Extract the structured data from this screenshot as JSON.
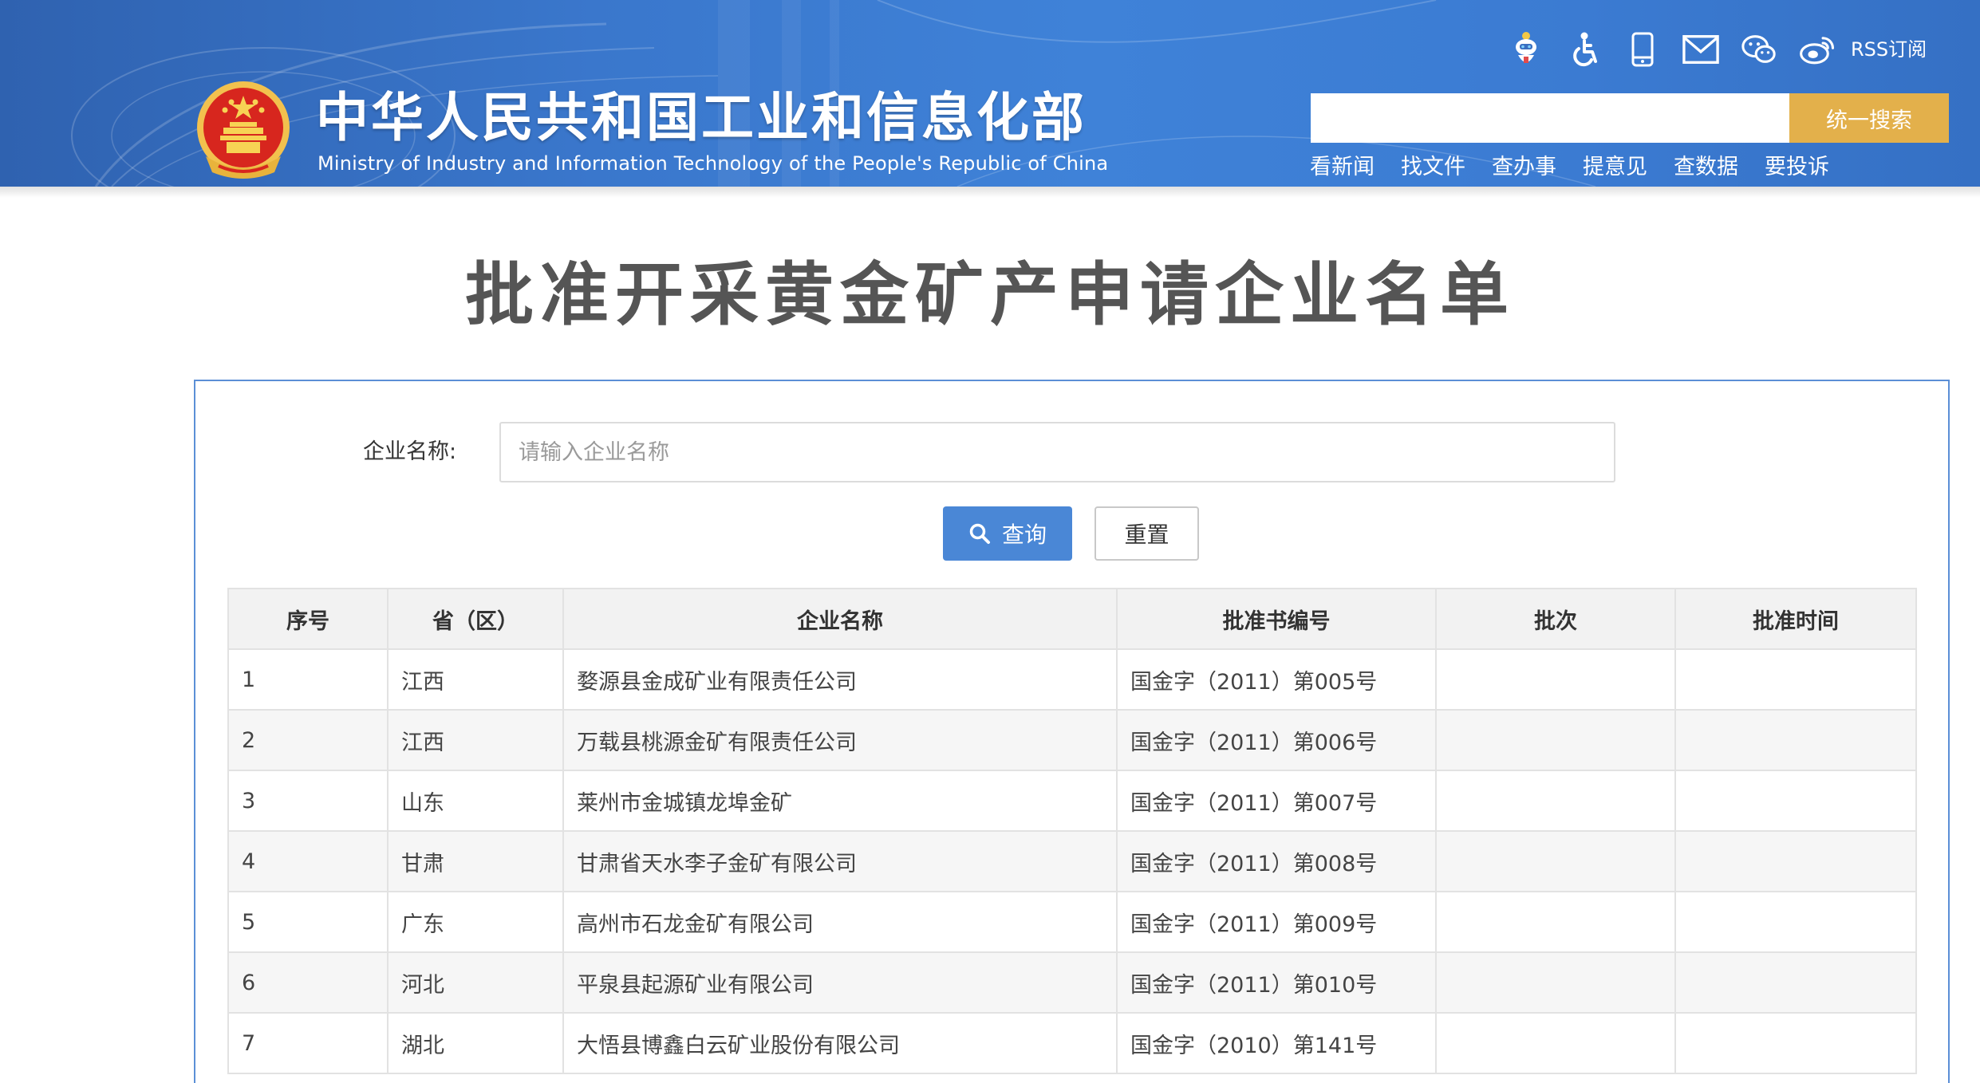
{
  "header": {
    "site_title": "中华人民共和国工业和信息化部",
    "site_subtitle": "Ministry of Industry and Information Technology of the People's Republic of China",
    "icons": [
      "robot-assistant-icon",
      "accessibility-icon",
      "mobile-icon",
      "mail-icon",
      "wechat-icon",
      "weibo-icon"
    ],
    "rss_label": "RSS订阅",
    "search": {
      "placeholder": "",
      "button_label": "统一搜索"
    },
    "nav": [
      "看新闻",
      "找文件",
      "查办事",
      "提意见",
      "查数据",
      "要投诉"
    ],
    "colors": {
      "header_blue": "#3a77cc",
      "search_button": "#e3b04b"
    }
  },
  "page": {
    "title": "批准开采黄金矿产申请企业名单"
  },
  "filter": {
    "label": "企业名称:",
    "input_placeholder": "请输入企业名称",
    "query_label": "查询",
    "reset_label": "重置",
    "colors": {
      "query_button": "#4a87d6",
      "panel_border": "#5b8fd6"
    }
  },
  "table": {
    "headers": [
      "序号",
      "省（区）",
      "企业名称",
      "批准书编号",
      "批次",
      "批准时间"
    ],
    "rows": [
      [
        "1",
        "江西",
        "婺源县金成矿业有限责任公司",
        "国金字（2011）第005号",
        "",
        ""
      ],
      [
        "2",
        "江西",
        "万载县桃源金矿有限责任公司",
        "国金字（2011）第006号",
        "",
        ""
      ],
      [
        "3",
        "山东",
        "莱州市金城镇龙埠金矿",
        "国金字（2011）第007号",
        "",
        ""
      ],
      [
        "4",
        "甘肃",
        "甘肃省天水李子金矿有限公司",
        "国金字（2011）第008号",
        "",
        ""
      ],
      [
        "5",
        "广东",
        "高州市石龙金矿有限公司",
        "国金字（2011）第009号",
        "",
        ""
      ],
      [
        "6",
        "河北",
        "平泉县起源矿业有限公司",
        "国金字（2011）第010号",
        "",
        ""
      ],
      [
        "7",
        "湖北",
        "大悟县博鑫白云矿业股份有限公司",
        "国金字（2010）第141号",
        "",
        ""
      ]
    ]
  }
}
